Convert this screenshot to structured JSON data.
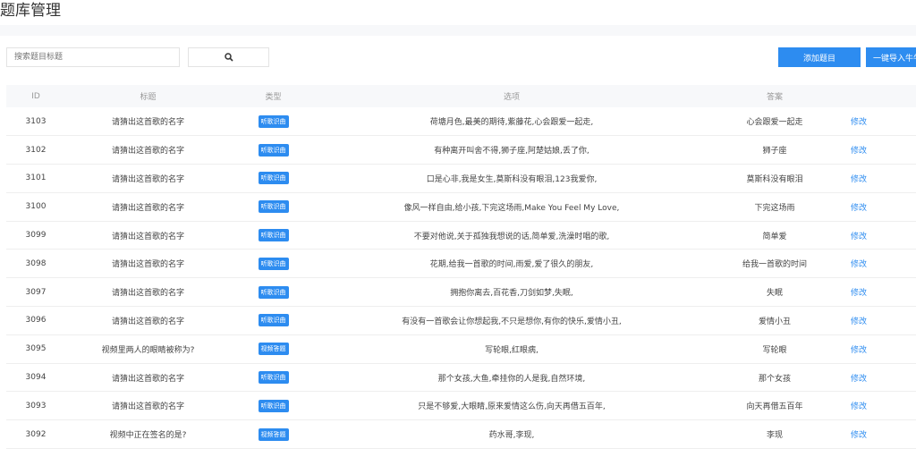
{
  "page_title": "题库管理",
  "search": {
    "placeholder": "搜索题目标题"
  },
  "buttons": {
    "add": "添加题目",
    "import": "一键导入牛牛"
  },
  "colors": {
    "accent": "#2d8cf0"
  },
  "table": {
    "headers": [
      "ID",
      "标题",
      "类型",
      "选项",
      "答案",
      ""
    ],
    "rows": [
      {
        "id": "3103",
        "title": "请猜出这首歌的名字",
        "type": "听歌识曲",
        "options": "荷塘月色,最美的期待,紫藤花,心会跟爱一起走,",
        "answer": "心会跟爱一起走",
        "action": "修改"
      },
      {
        "id": "3102",
        "title": "请猜出这首歌的名字",
        "type": "听歌识曲",
        "options": "有种离开叫舍不得,狮子座,阿楚姑娘,丢了你,",
        "answer": "狮子座",
        "action": "修改"
      },
      {
        "id": "3101",
        "title": "请猜出这首歌的名字",
        "type": "听歌识曲",
        "options": "口是心非,我是女生,莫斯科没有眼泪,123我爱你,",
        "answer": "莫斯科没有眼泪",
        "action": "修改"
      },
      {
        "id": "3100",
        "title": "请猜出这首歌的名字",
        "type": "听歌识曲",
        "options": "像风一样自由,给小孩,下完这场雨,Make You Feel My Love,",
        "answer": "下完这场雨",
        "action": "修改"
      },
      {
        "id": "3099",
        "title": "请猜出这首歌的名字",
        "type": "听歌识曲",
        "options": "不要对他说,关于孤独我想说的话,简单爱,洗澡时唱的歌,",
        "answer": "简单爱",
        "action": "修改"
      },
      {
        "id": "3098",
        "title": "请猜出这首歌的名字",
        "type": "听歌识曲",
        "options": "花期,给我一首歌的时间,雨爱,爱了很久的朋友,",
        "answer": "给我一首歌的时间",
        "action": "修改"
      },
      {
        "id": "3097",
        "title": "请猜出这首歌的名字",
        "type": "听歌识曲",
        "options": "拥抱你离去,百花香,刀剑如梦,失眠,",
        "answer": "失眠",
        "action": "修改"
      },
      {
        "id": "3096",
        "title": "请猜出这首歌的名字",
        "type": "听歌识曲",
        "options": "有没有一首歌会让你想起我,不只是想你,有你的快乐,爱情小丑,",
        "answer": "爱情小丑",
        "action": "修改"
      },
      {
        "id": "3095",
        "title": "视频里两人的眼睛被称为?",
        "type": "视频答题",
        "options": "写轮眼,红眼病,",
        "answer": "写轮眼",
        "action": "修改"
      },
      {
        "id": "3094",
        "title": "请猜出这首歌的名字",
        "type": "听歌识曲",
        "options": "那个女孩,大鱼,牵挂你的人是我,自然环境,",
        "answer": "那个女孩",
        "action": "修改"
      },
      {
        "id": "3093",
        "title": "请猜出这首歌的名字",
        "type": "听歌识曲",
        "options": "只是不够爱,大眼睛,原来爱情这么伤,向天再借五百年,",
        "answer": "向天再借五百年",
        "action": "修改"
      },
      {
        "id": "3092",
        "title": "视频中正在签名的是?",
        "type": "视频答题",
        "options": "药水哥,李现,",
        "answer": "李现",
        "action": "修改"
      }
    ]
  }
}
